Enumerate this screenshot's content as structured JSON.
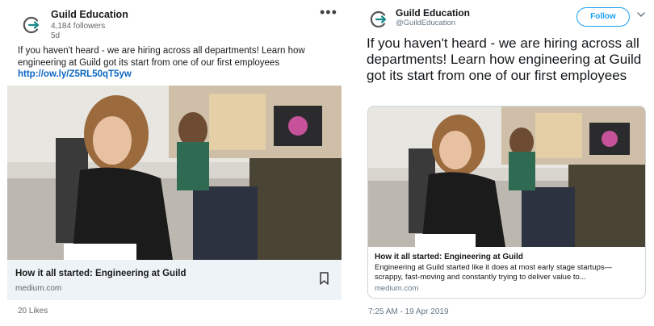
{
  "linkedin": {
    "company_name": "Guild Education",
    "followers": "4,184 followers",
    "time_ago": "5d",
    "more_icon": "more-horizontal-icon",
    "post_text": "If you haven't heard - we are hiring across all departments!  Learn how engineering at Guild got its start from one of our first employees",
    "link": "http://ow.ly/Z5RL50qT5yw",
    "card_title": "How it all started: Engineering at Guild",
    "card_source": "medium.com",
    "bookmark_icon": "bookmark-icon",
    "likes": "20 Likes"
  },
  "twitter": {
    "name": "Guild Education",
    "handle": "@GuildEducation",
    "follow_label": "Follow",
    "chevron_icon": "chevron-down-icon",
    "tweet_text": "If you haven't heard - we are hiring across all departments!  Learn how engineering at Guild got its start from one of our first employees",
    "card_title": "How it all started: Engineering at Guild",
    "card_desc": "Engineering at Guild started like it does at most early stage startups—scrappy, fast-moving and constantly trying to deliver value to...",
    "card_source": "medium.com",
    "timestamp": "7:25 AM - 19 Apr 2019"
  },
  "colors": {
    "link_blue": "#0a66c2",
    "twitter_blue": "#1da1f2",
    "card_bg": "#eef3f8",
    "logo_teal": "#1a8b8a"
  }
}
